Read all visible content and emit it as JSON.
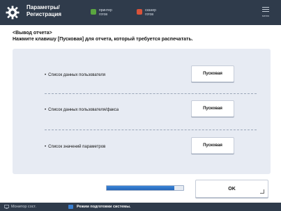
{
  "header": {
    "title_line1": "Параметры/",
    "title_line2": "Регистрация",
    "status_left": [
      "принтер",
      "готов"
    ],
    "status_right": [
      "сканер",
      "готов"
    ],
    "menu_label": "меню"
  },
  "page": {
    "heading_line1": "<Вывод отчета>",
    "heading_line2": "Нажмите клавишу [Пусковая] для отчета, который требуется распечатать."
  },
  "rows": [
    {
      "label": "Список данных пользователя",
      "button": "Пусковая"
    },
    {
      "label": "Список данных пользователя/факса",
      "button": "Пусковая"
    },
    {
      "label": "Список значений параметров",
      "button": "Пусковая"
    }
  ],
  "footer": {
    "ok_label": "OK",
    "progress_fraction": 0.88
  },
  "statusbar": {
    "left_text": "Монитор сост.",
    "right_text": "Режим подготовки системы."
  },
  "colors": {
    "topbar": "#2f3b4b",
    "panel": "#e7ebf3",
    "progress": "#2f78cf"
  },
  "icons": {
    "settings": "gear-icon",
    "menu": "menu-icon",
    "monitor": "monitor-icon",
    "message": "message-icon"
  }
}
